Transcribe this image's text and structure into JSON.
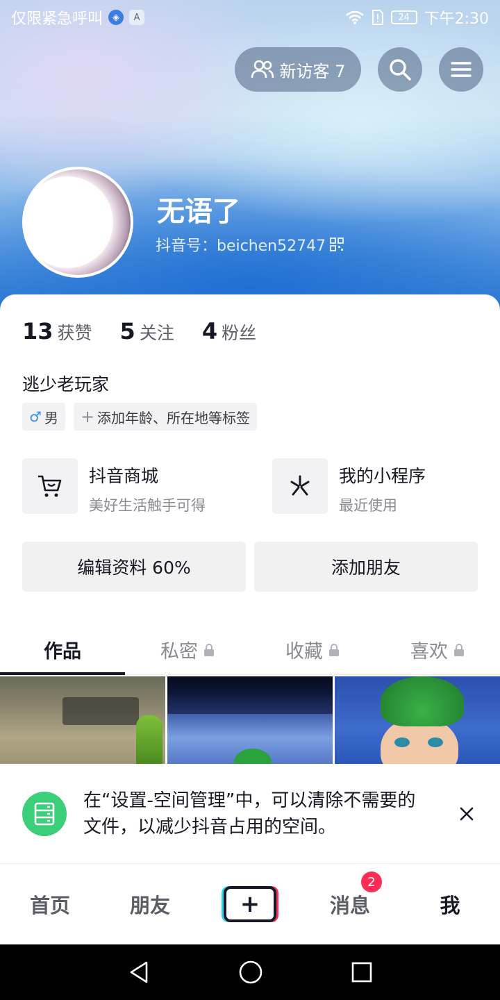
{
  "statusbar": {
    "carrier": "仅限紧急呼叫",
    "battery": "24",
    "time": "下午2:30",
    "icons": [
      "sim-icon",
      "a-badge-icon",
      "wifi-icon",
      "sim-alert-icon",
      "battery-icon"
    ]
  },
  "header": {
    "visitor_label": "新访客 7",
    "search_icon": "search-icon",
    "menu_icon": "menu-icon"
  },
  "profile": {
    "name": "无语了",
    "douyin_id": "抖音号：beichen52747",
    "stats": [
      {
        "num": "13",
        "label": "获赞"
      },
      {
        "num": "5",
        "label": "关注"
      },
      {
        "num": "4",
        "label": "粉丝"
      }
    ],
    "bio": "逃少老玩家",
    "tags": {
      "gender": "男",
      "add_tag": "添加年龄、所在地等标签"
    }
  },
  "entries": [
    {
      "title": "抖音商城",
      "subtitle": "美好生活触手可得",
      "icon": "cart-icon"
    },
    {
      "title": "我的小程序",
      "subtitle": "最近使用",
      "icon": "mini-program-icon"
    }
  ],
  "actions": {
    "edit": "编辑资料 60%",
    "add_friend": "添加朋友"
  },
  "tabs": [
    {
      "label": "作品",
      "locked": false
    },
    {
      "label": "私密",
      "locked": true
    },
    {
      "label": "收藏",
      "locked": true
    },
    {
      "label": "喜欢",
      "locked": true
    }
  ],
  "notice": {
    "text": "在“设置-空间管理”中，可以清除不需要的文件，以减少抖音占用的空间。"
  },
  "bottomnav": {
    "home": "首页",
    "friends": "朋友",
    "plus": "+",
    "messages": "消息",
    "messages_badge": "2",
    "me": "我"
  },
  "colors": {
    "accent": "#fe2c55",
    "notice_icon": "#3ccf7a",
    "text_primary": "#161823",
    "text_secondary": "#8a8b91"
  }
}
